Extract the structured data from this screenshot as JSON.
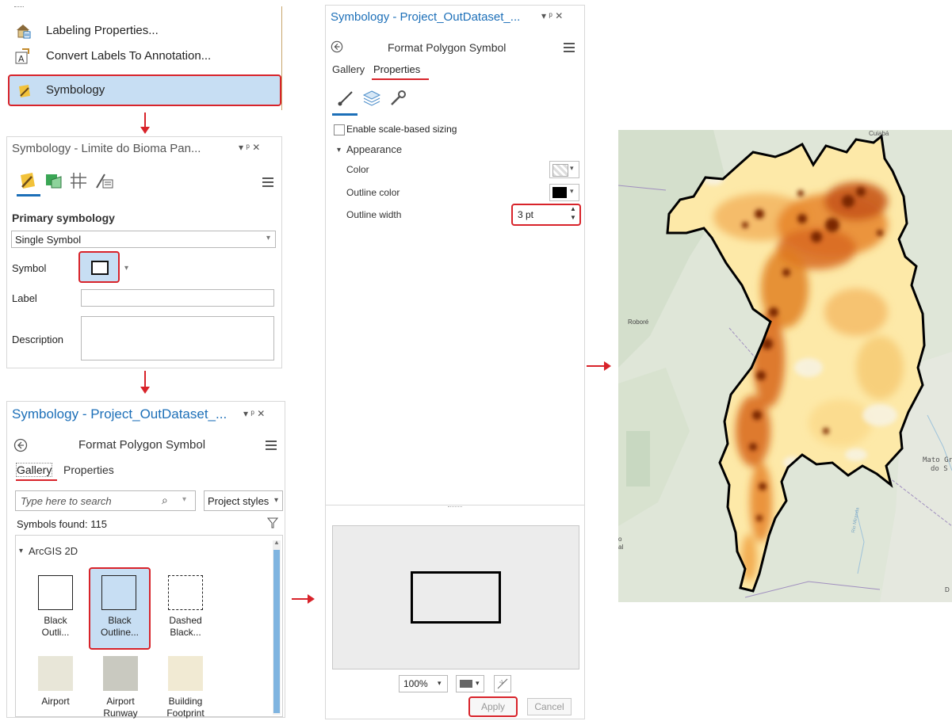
{
  "context_menu": {
    "items": [
      {
        "label": "Labeling Properties...",
        "icon": "labeling-properties-icon"
      },
      {
        "label": "Convert Labels To Annotation...",
        "icon": "convert-annotation-icon"
      },
      {
        "label": "Symbology",
        "icon": "symbology-brush-icon",
        "highlighted": true
      }
    ]
  },
  "symbology_panel": {
    "title": "Symbology - Limite do Bioma Pan...",
    "title_controls": "▾ ᵖ ✕",
    "primary_heading": "Primary symbology",
    "renderer": "Single Symbol",
    "symbol_label": "Symbol",
    "label_label": "Label",
    "description_label": "Description"
  },
  "gallery_panel": {
    "title": "Symbology - Project_OutDataset_...",
    "title_controls": "▾ ᵖ ✕",
    "heading": "Format Polygon Symbol",
    "tabs": [
      "Gallery",
      "Properties"
    ],
    "search_placeholder": "Type here to search",
    "styles_dropdown": "Project styles",
    "symbols_found": "Symbols found: 115",
    "group": "ArcGIS 2D",
    "symbols": [
      {
        "label_line1": "Black",
        "label_line2": "Outli...",
        "kind": "outline"
      },
      {
        "label_line1": "Black",
        "label_line2": "Outline...",
        "kind": "outline-selected"
      },
      {
        "label_line1": "Dashed",
        "label_line2": "Black...",
        "kind": "dashed"
      },
      {
        "label_line1": "Airport",
        "label_line2": "",
        "kind": "fill",
        "color": "#e8e6d8"
      },
      {
        "label_line1": "Airport",
        "label_line2": "Runway",
        "kind": "fill",
        "color": "#c9c9c0"
      },
      {
        "label_line1": "Building",
        "label_line2": "Footprint",
        "kind": "fill",
        "color": "#f1ead3"
      }
    ]
  },
  "properties_panel": {
    "title": "Symbology - Project_OutDataset_...",
    "title_controls": "▾ ᵖ ✕",
    "heading": "Format Polygon Symbol",
    "tabs": [
      "Gallery",
      "Properties"
    ],
    "enable_scale": "Enable scale-based sizing",
    "appearance": "Appearance",
    "color_label": "Color",
    "outline_color_label": "Outline color",
    "outline_width_label": "Outline width",
    "outline_width_value": "3 pt",
    "zoom": "100%",
    "apply": "Apply",
    "cancel": "Cancel"
  },
  "map": {
    "labels": {
      "cuiaba": "Cuiabá",
      "robore": "Roboré",
      "mato_grosso_1": "Mato Gr",
      "mato_grosso_2": "do S",
      "river": "Rio Miranda",
      "edge1": "o",
      "edge2": "al",
      "edge3": "D"
    }
  },
  "colors": {
    "accent_red": "#d8232a",
    "title_blue": "#1c6fb8",
    "highlight_blue": "#c7def3",
    "heat_dark": "#8a2d00",
    "heat_mid": "#e07a1a",
    "heat_light": "#fde9a8"
  }
}
